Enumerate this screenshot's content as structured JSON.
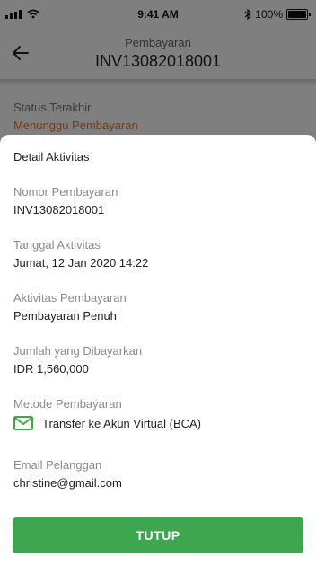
{
  "status_bar": {
    "time": "9:41 AM",
    "battery": "100%"
  },
  "header": {
    "subtitle": "Pembayaran",
    "title": "INV13082018001"
  },
  "status": {
    "label": "Status Terakhir",
    "value": "Menunggu Pembayaran"
  },
  "sheet": {
    "title": "Detail Aktivitas",
    "fields": [
      {
        "label": "Nomor Pembayaran",
        "value": "INV13082018001"
      },
      {
        "label": "Tanggal Aktivitas",
        "value": "Jumat, 12 Jan 2020 14:22"
      },
      {
        "label": "Aktivitas Pembayaran",
        "value": "Pembayaran Penuh"
      },
      {
        "label": "Jumlah yang Dibayarkan",
        "value": "IDR 1,560,000"
      },
      {
        "label": "Metode Pembayaran",
        "value": "Transfer ke Akun Virtual (BCA)"
      },
      {
        "label": "Email Pelanggan",
        "value": "christine@gmail.com"
      }
    ],
    "button_label": "TUTUP"
  },
  "colors": {
    "accent": "#3ea64e",
    "status": "#e37b2c"
  }
}
